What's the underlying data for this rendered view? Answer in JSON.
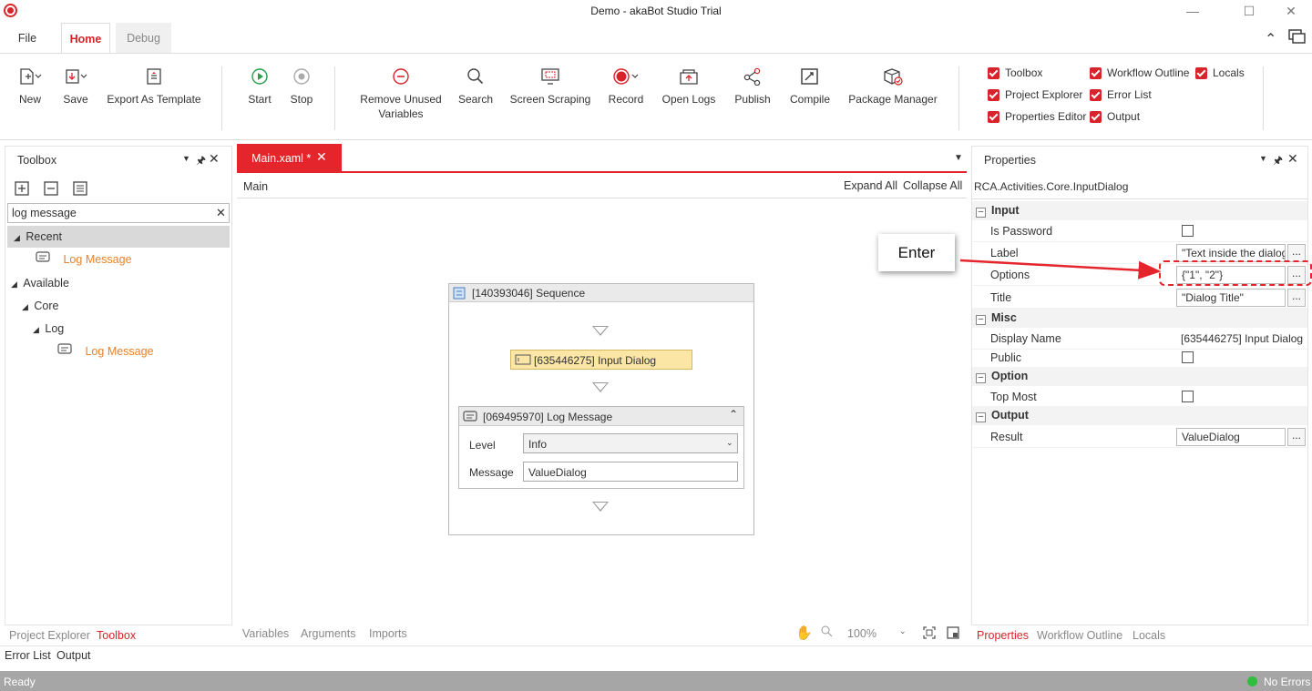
{
  "window": {
    "title": "Demo - akaBot Studio Trial"
  },
  "menu": {
    "file": "File",
    "home": "Home",
    "debug": "Debug"
  },
  "ribbon": {
    "new": "New",
    "save": "Save",
    "export_template": "Export As Template",
    "start": "Start",
    "stop": "Stop",
    "remove_unused_1": "Remove Unused",
    "remove_unused_2": "Variables",
    "search": "Search",
    "screen_scraping": "Screen Scraping",
    "record": "Record",
    "open_logs": "Open Logs",
    "publish": "Publish",
    "compile": "Compile",
    "package_manager": "Package Manager",
    "panels": {
      "toolbox": "Toolbox",
      "project_explorer": "Project Explorer",
      "properties_editor": "Properties Editor",
      "workflow_outline": "Workflow Outline",
      "error_list": "Error List",
      "output": "Output",
      "locals": "Locals"
    }
  },
  "toolbox": {
    "title": "Toolbox",
    "search_value": "log message",
    "recent": "Recent",
    "recent_item": "Log Message",
    "available": "Available",
    "core": "Core",
    "log": "Log",
    "log_item": "Log Message"
  },
  "document": {
    "tab": "Main.xaml *",
    "breadcrumb": "Main",
    "expand_all": "Expand All",
    "collapse_all": "Collapse All",
    "sequence_title": "[140393046] Sequence",
    "input_dialog": "[635446275] Input Dialog",
    "log_message_title": "[069495970] Log Message",
    "level_label": "Level",
    "level_value": "Info",
    "message_label": "Message",
    "message_value": "ValueDialog",
    "bottom_tabs": [
      "Variables",
      "Arguments",
      "Imports"
    ],
    "zoom": "100%"
  },
  "properties": {
    "title": "Properties",
    "type_name": "RCA.Activities.Core.InputDialog",
    "cat_input": "Input",
    "is_password": "Is Password",
    "label": "Label",
    "label_value": "\"Text inside the dialog\"",
    "options": "Options",
    "options_value": "{\"1\", \"2\"}",
    "title_prop": "Title",
    "title_value": "\"Dialog Title\"",
    "cat_misc": "Misc",
    "display_name": "Display Name",
    "display_name_value": "[635446275] Input Dialog",
    "public": "Public",
    "cat_option": "Option",
    "top_most": "Top Most",
    "cat_output": "Output",
    "result": "Result",
    "result_value": "ValueDialog",
    "dots": "..."
  },
  "annotation": {
    "callout": "Enter"
  },
  "left_bottom_tabs": {
    "project_explorer": "Project Explorer",
    "toolbox": "Toolbox",
    "error_list": "Error List",
    "output": "Output"
  },
  "right_bottom_tabs": {
    "properties": "Properties",
    "workflow_outline": "Workflow Outline",
    "locals": "Locals"
  },
  "status": {
    "left": "Ready",
    "right": "No Errors"
  },
  "colors": {
    "accent": "#d8232a",
    "highlight": "#fbe6a6",
    "status_ok": "#2fbf3c"
  }
}
